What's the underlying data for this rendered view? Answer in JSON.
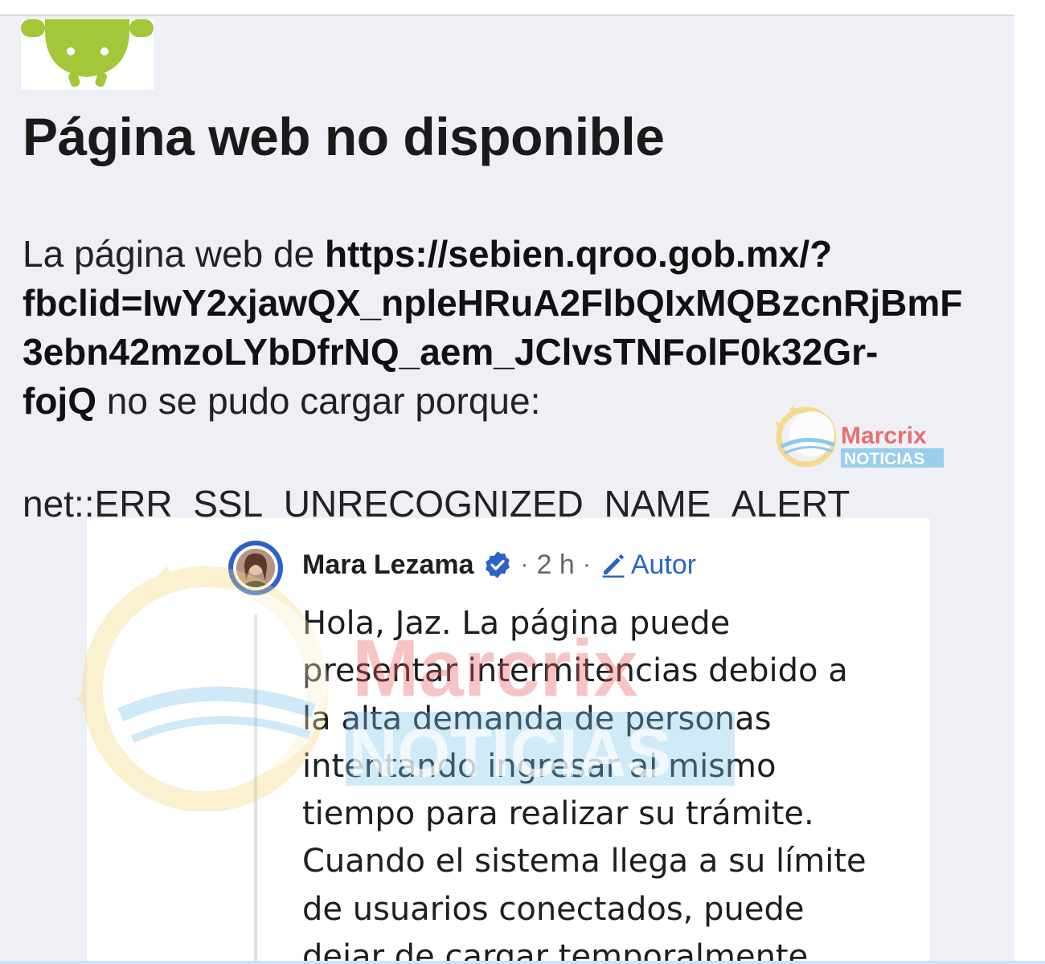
{
  "error_page": {
    "title": "Página web no disponible",
    "body_prefix": "La página web de ",
    "url_line1": "https://sebien.qroo.gob.mx/?",
    "url_line2": "fbclid=IwY2xjawQX_npleHRuA2FlbQIxMQBzcnRjBmF",
    "url_line3": "3ebn42mzoLYbDfrNQ_aem_JClvsTNFolF0k32Gr-",
    "url_line4": "fojQ",
    "body_suffix": " no se pudo cargar porque:",
    "error_code": "net::ERR_SSL_UNRECOGNIZED_NAME_ALERT",
    "logo_icon": "android-robot-icon",
    "logo_color": "#a4c639"
  },
  "watermark": {
    "brand_top": "Marcrix",
    "brand_bottom": "NOTICIAS",
    "colors": {
      "red": "#e85a5a",
      "blue": "#7cc3ea",
      "gold": "#f5d77a"
    }
  },
  "comment": {
    "author": "Mara Lezama",
    "verified_icon": "verified-badge-icon",
    "separator": "·",
    "time": "2 h",
    "role_icon": "pencil-icon",
    "role_label": "Autor",
    "text": "Hola, Jaz. La página puede\npresentar intermitencias debido a\nla alta demanda de personas\nintentando ingresar al mismo\ntiempo para realizar su trámite.\nCuando el sistema llega a su límite\nde usuarios conectados, puede\ndejar de cargar temporalmente.",
    "accent_color": "#2a62c9"
  }
}
